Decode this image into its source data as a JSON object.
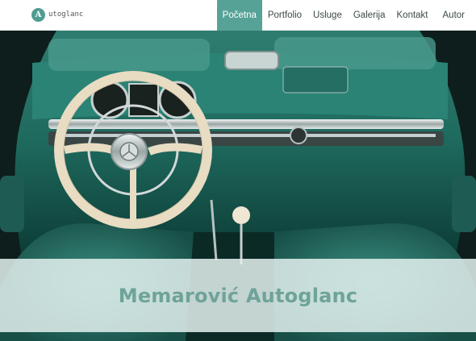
{
  "header": {
    "logo": {
      "badge_letter": "A",
      "text": "utoglanc"
    },
    "nav": [
      {
        "label": "Početna",
        "active": true
      },
      {
        "label": "Portfolio",
        "active": false
      },
      {
        "label": "Usluge",
        "active": false
      },
      {
        "label": "Galerija",
        "active": false
      },
      {
        "label": "Kontakt",
        "active": false
      },
      {
        "label": "Autor",
        "active": false
      }
    ]
  },
  "hero": {
    "image": "classic-car-interior-photo",
    "title": "Memarović Autoglanc"
  },
  "colors": {
    "accent": "#57a297",
    "title_text": "#6fa399",
    "title_band": "#e2f0ed"
  }
}
